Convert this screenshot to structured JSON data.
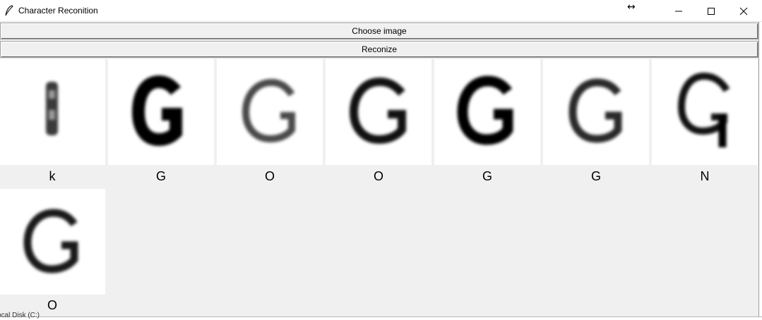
{
  "window": {
    "title": "Character Reconition",
    "icons": {
      "app": "feather-icon",
      "cursor": "resize-horizontal-icon",
      "minimize": "minimize-icon",
      "maximize": "maximize-icon",
      "close": "close-icon"
    },
    "resize_glyph": "↔"
  },
  "buttons": {
    "choose_image": "Choose image",
    "recognize": "Reconize"
  },
  "results": [
    {
      "label": "k"
    },
    {
      "label": "G"
    },
    {
      "label": "O"
    },
    {
      "label": "O"
    },
    {
      "label": "G"
    },
    {
      "label": "G"
    },
    {
      "label": "N"
    },
    {
      "label": "O"
    }
  ],
  "background_partial_text": "ocal Disk (C:)"
}
